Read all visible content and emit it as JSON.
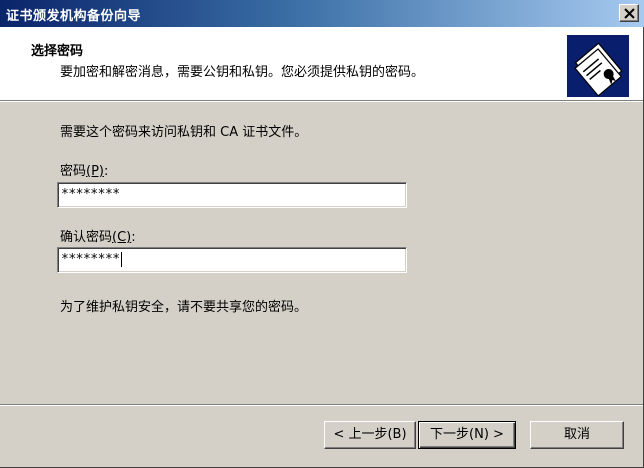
{
  "window": {
    "title": "证书颁发机构备份向导"
  },
  "header": {
    "title": "选择密码",
    "subtitle": "要加密和解密消息，需要公钥和私钥。您必须提供私钥的密码。",
    "icon": "certificate-wizard-icon"
  },
  "body": {
    "intro": "需要这个密码来访问私钥和 CA 证书文件。",
    "password_label": "密码",
    "password_accel": "(P)",
    "password_label_suffix": ":",
    "password_value": "********",
    "confirm_label": "确认密码",
    "confirm_accel": "(C)",
    "confirm_label_suffix": ":",
    "confirm_value": "********",
    "note": "为了维护私钥安全，请不要共享您的密码。"
  },
  "buttons": {
    "back_label": "< 上一步(B)",
    "next_label": "下一步(N) >",
    "cancel_label": "取消"
  },
  "colors": {
    "dialog_bg": "#d4d0c8",
    "titlebar_start": "#0a246a",
    "titlebar_end": "#a6caf0",
    "icon_bg": "#0a1e6e"
  }
}
